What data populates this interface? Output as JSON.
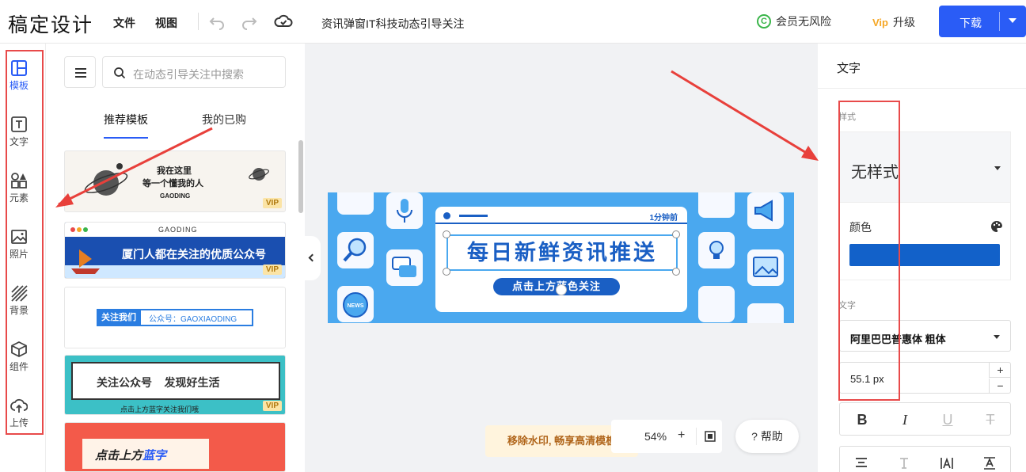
{
  "app": {
    "logo": "稿定设计"
  },
  "topbar": {
    "menu_file": "文件",
    "menu_view": "视图",
    "doc_title": "资讯弹窗IT科技动态引导关注",
    "member_badge": "C",
    "member_text": "会员无风险",
    "upgrade_badge": "Vip",
    "upgrade_text": "升级",
    "download": "下载"
  },
  "rail": {
    "items": [
      {
        "label": "模板",
        "icon": "layout-icon",
        "active": true
      },
      {
        "label": "文字",
        "icon": "text-icon"
      },
      {
        "label": "元素",
        "icon": "shapes-icon"
      },
      {
        "label": "照片",
        "icon": "image-icon"
      },
      {
        "label": "背景",
        "icon": "texture-icon"
      },
      {
        "label": "组件",
        "icon": "cube-icon"
      },
      {
        "label": "上传",
        "icon": "upload-cloud-icon"
      }
    ]
  },
  "panel": {
    "search_placeholder": "在动态引导关注中搜索",
    "tabs": [
      {
        "label": "推荐模板",
        "active": true
      },
      {
        "label": "我的已购"
      }
    ],
    "templates": [
      {
        "line1": "我在这里",
        "line2": "等一个懂我的人",
        "line3": "GAODING",
        "vip": "VIP"
      },
      {
        "header": "GAODING",
        "text": "厦门人都在关注的优质公众号",
        "vip": "VIP"
      },
      {
        "label": "关注我们",
        "value": "公众号：GAOXIAODING"
      },
      {
        "title": "关注公众号    发现好生活",
        "footer": "点击上方蓝字关注我们哦",
        "vip": "VIP"
      },
      {
        "text": "点击上方",
        "highlight": "蓝字"
      }
    ]
  },
  "canvas": {
    "time": "1分钟前",
    "headline": "每日新鲜资讯推送",
    "subline": "点击上方蓝色关注",
    "news_badge": "NEWS",
    "bg": "#4aa8ef",
    "accent": "#1a5fc4"
  },
  "bottom": {
    "watermark": "移除水印, 畅享高清模板",
    "zoom": "54%",
    "zoom_in": "+",
    "help": "? 帮助"
  },
  "props": {
    "title": "文字",
    "style_label": "样式",
    "style_value": "无样式",
    "color_label": "颜色",
    "color_value": "#1261c9",
    "text_label": "文字",
    "font": "阿里巴巴普惠体 粗体",
    "size": "55.1 px",
    "plus": "+",
    "minus": "−",
    "bold": "B",
    "italic": "I",
    "underline": "U",
    "strike": "T"
  }
}
